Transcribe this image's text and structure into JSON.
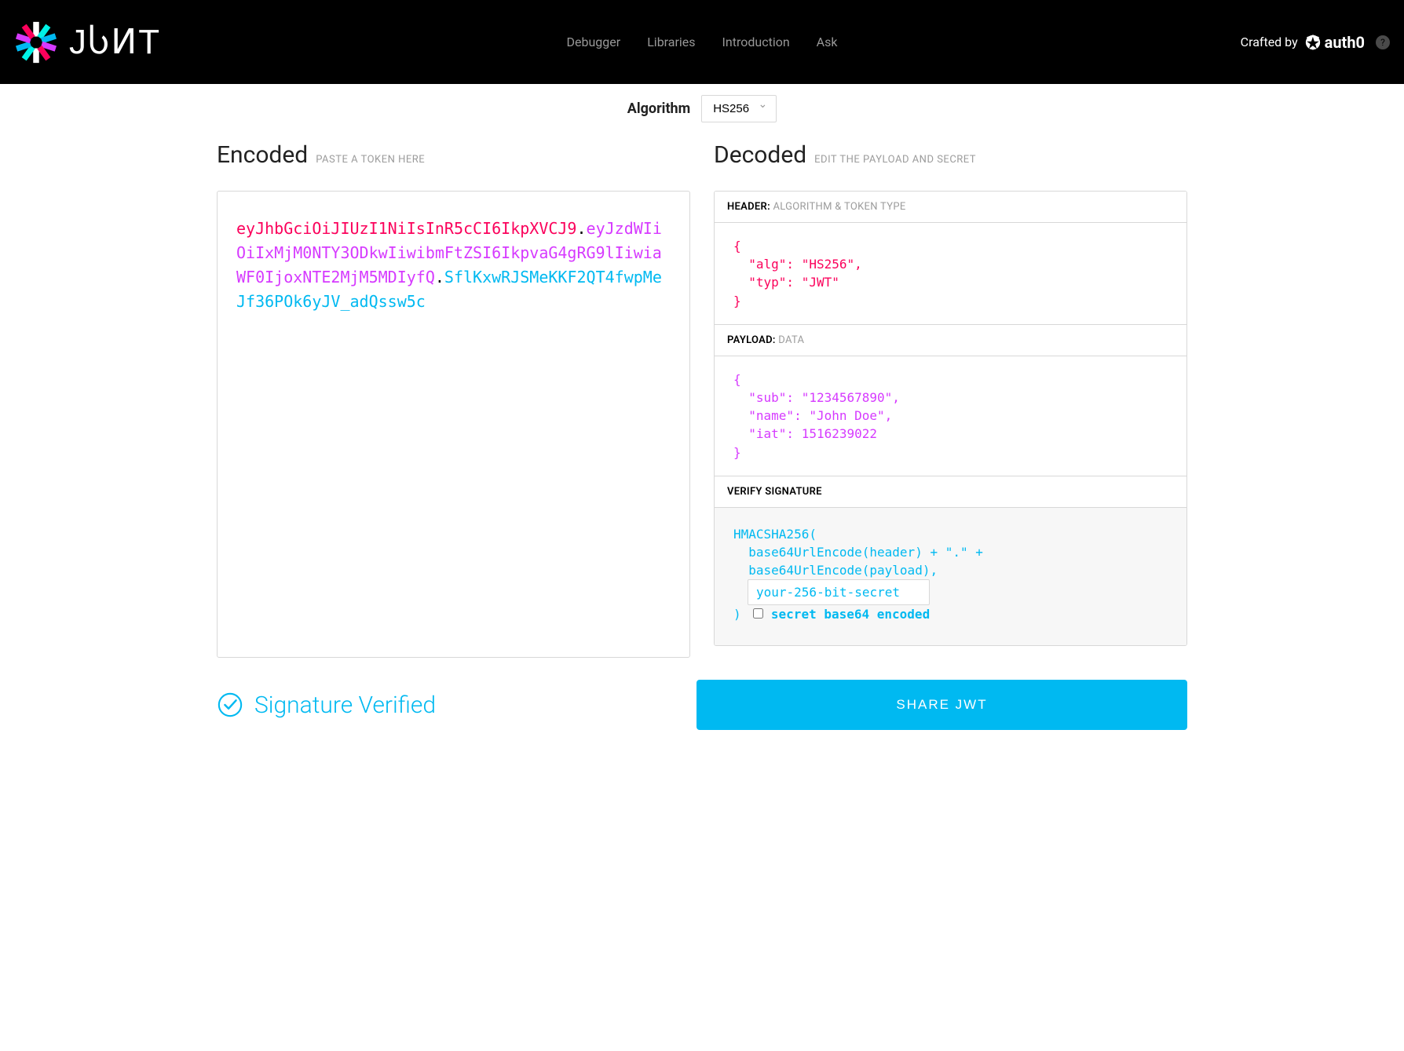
{
  "nav": {
    "debugger": "Debugger",
    "libraries": "Libraries",
    "introduction": "Introduction",
    "ask": "Ask"
  },
  "crafted": {
    "label": "Crafted by",
    "brand": "auth0"
  },
  "algorithm": {
    "label": "Algorithm",
    "selected": "HS256"
  },
  "encoded": {
    "title": "Encoded",
    "sub": "PASTE A TOKEN HERE",
    "token_header": "eyJhbGciOiJIUzI1NiIsInR5cCI6IkpXVCJ9",
    "token_payload": "eyJzdWIiOiIxMjM0NTY3ODkwIiwibmFtZSI6IkpvaG4gRG9lIiwiaWF0IjoxNTE2MjM5MDIyfQ",
    "token_signature": "SflKxwRJSMeKKF2QT4fwpMeJf36POk6yJV_adQssw5c"
  },
  "decoded": {
    "title": "Decoded",
    "sub": "EDIT THE PAYLOAD AND SECRET",
    "header_label": "HEADER:",
    "header_sub": "ALGORITHM & TOKEN TYPE",
    "header_body": "{\n  \"alg\": \"HS256\",\n  \"typ\": \"JWT\"\n}",
    "payload_label": "PAYLOAD:",
    "payload_sub": "DATA",
    "payload_body": "{\n  \"sub\": \"1234567890\",\n  \"name\": \"John Doe\",\n  \"iat\": 1516239022\n}",
    "signature_label": "VERIFY SIGNATURE",
    "signature_line1": "HMACSHA256(",
    "signature_line2": "  base64UrlEncode(header) + \".\" +",
    "signature_line3": "  base64UrlEncode(payload),",
    "signature_secret_value": "your-256-bit-secret",
    "signature_close": ") ",
    "signature_cb_label": "secret base64 encoded"
  },
  "verified": {
    "label": "Signature Verified"
  },
  "share": {
    "label": "SHARE JWT"
  },
  "colors": {
    "header": "#fb015b",
    "payload": "#d63aff",
    "signature": "#00b9f1"
  }
}
